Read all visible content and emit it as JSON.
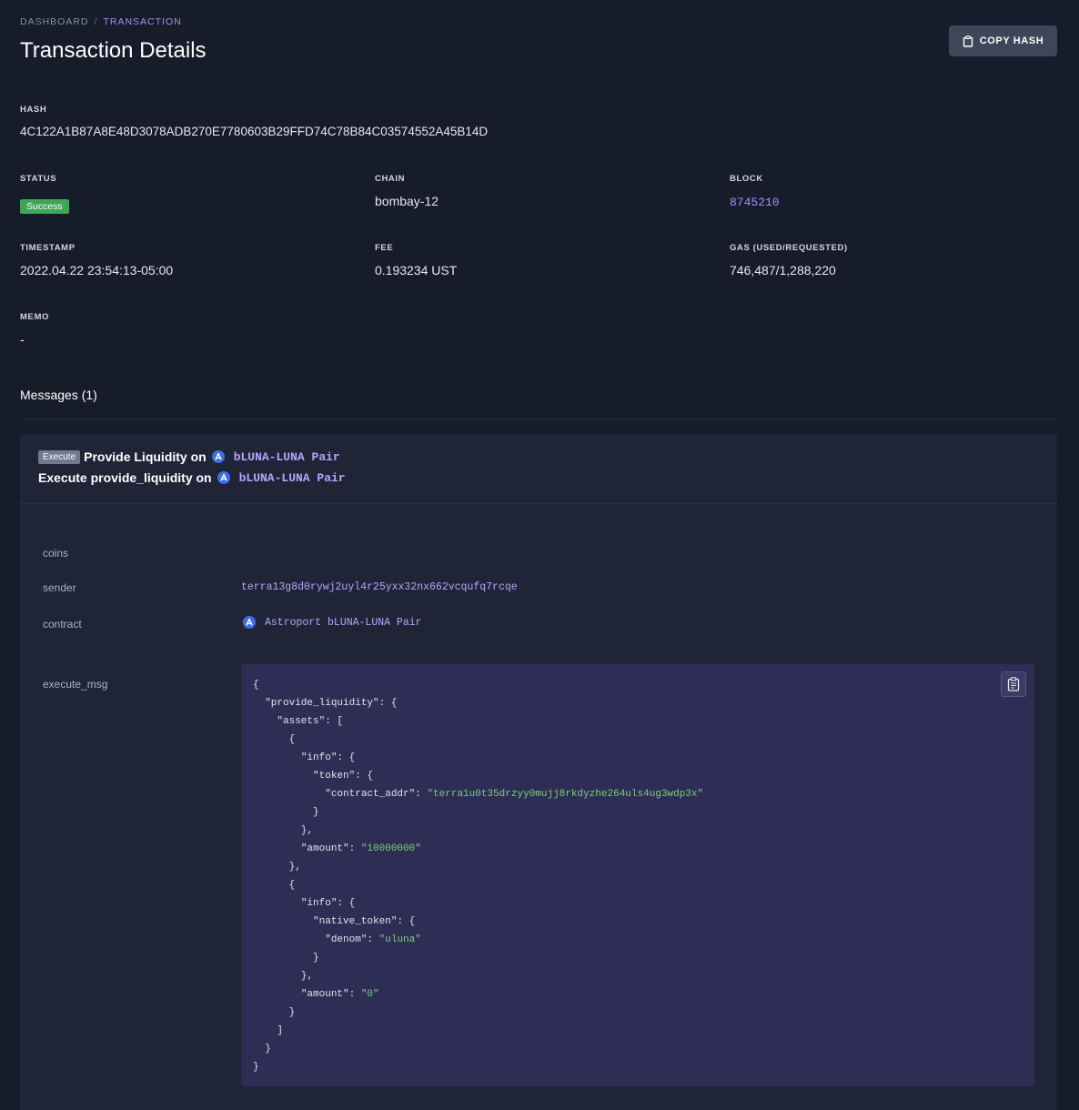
{
  "breadcrumb": {
    "items": [
      "DASHBOARD",
      "TRANSACTION"
    ],
    "separator": "/"
  },
  "page": {
    "title": "Transaction Details",
    "copy_hash_label": "COPY HASH"
  },
  "details": {
    "hash": {
      "label": "HASH",
      "value": "4C122A1B87A8E48D3078ADB270E7780603B29FFD74C78B84C03574552A45B14D"
    },
    "status": {
      "label": "STATUS",
      "value": "Success"
    },
    "chain": {
      "label": "CHAIN",
      "value": "bombay-12"
    },
    "block": {
      "label": "BLOCK",
      "value": "8745210"
    },
    "timestamp": {
      "label": "TIMESTAMP",
      "value": "2022.04.22 23:54:13-05:00"
    },
    "fee": {
      "label": "FEE",
      "value": "0.193234 UST"
    },
    "gas": {
      "label": "GAS (USED/REQUESTED)",
      "value": "746,487/1,288,220"
    },
    "memo": {
      "label": "MEMO",
      "value": "-"
    }
  },
  "messages": {
    "title": "Messages (1)",
    "items": [
      {
        "badge": "Execute",
        "headline_prefix": "Provide Liquidity on",
        "headline_pair": "bLUNA-LUNA Pair",
        "subline_prefix": "Execute provide_liquidity on",
        "subline_pair": "bLUNA-LUNA Pair",
        "rows": {
          "coins": {
            "label": "coins",
            "value": ""
          },
          "sender": {
            "label": "sender",
            "value": "terra13g8d0rywj2uyl4r25yxx32nx662vcqufq7rcqe"
          },
          "contract": {
            "label": "contract",
            "value": "Astroport bLUNA-LUNA Pair"
          },
          "execute_msg": {
            "label": "execute_msg"
          }
        },
        "execute_msg": {
          "key_provide_liquidity": "\"provide_liquidity\"",
          "key_assets": "\"assets\"",
          "key_info": "\"info\"",
          "key_token": "\"token\"",
          "key_contract_addr": "\"contract_addr\"",
          "val_contract_addr": "\"terra1u0t35drzyy0mujj8rkdyzhe264uls4ug3wdp3x\"",
          "key_amount": "\"amount\"",
          "val_amount_1": "\"10000000\"",
          "key_native_token": "\"native_token\"",
          "key_denom": "\"denom\"",
          "val_denom": "\"uluna\"",
          "val_amount_2": "\"0\""
        }
      }
    ]
  },
  "icons": {
    "copy_hash": "clipboard-icon",
    "code_copy": "clipboard-list-icon",
    "protocol": "astroport-icon"
  },
  "colors": {
    "background": "#171c2b",
    "card": "#1f2536",
    "accent": "#a98ef6",
    "success": "#3fa55a",
    "code_bg": "#2d2d55",
    "code_string": "#7cd07c"
  }
}
